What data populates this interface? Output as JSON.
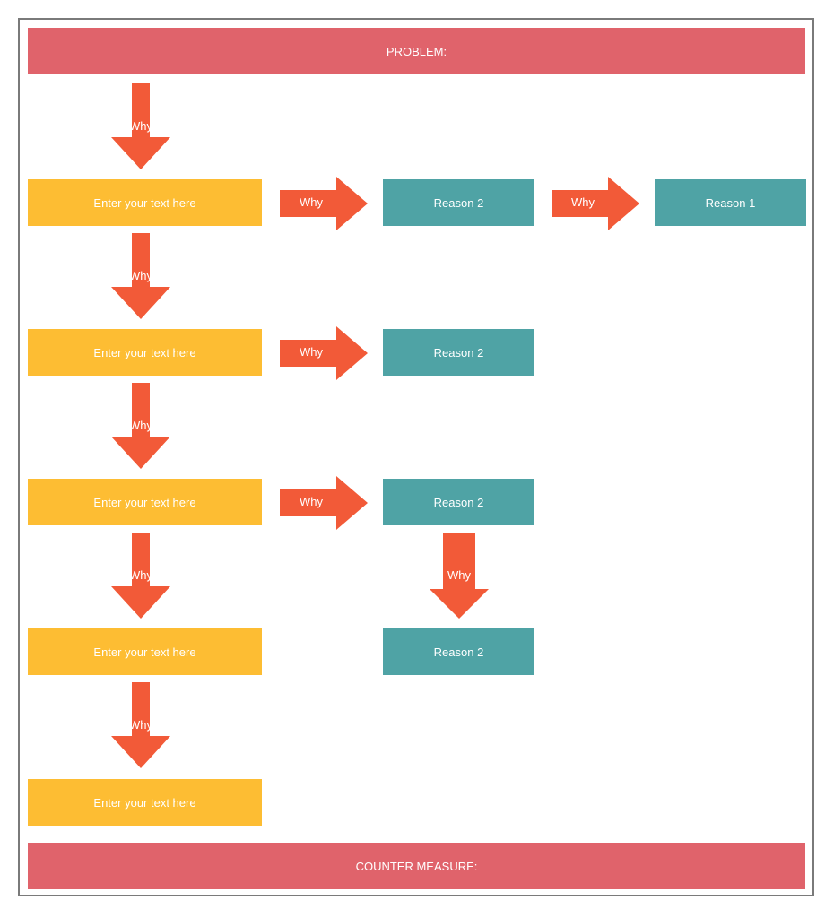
{
  "colors": {
    "banner": "#e0636b",
    "step": "#fdbd33",
    "reason": "#4fa3a5",
    "arrow": "#f25a38",
    "frame": "#7a7a7a"
  },
  "problem_label": "PROBLEM:",
  "counter_measure_label": "COUNTER MEASURE:",
  "arrow_label": "Why",
  "steps": [
    {
      "text": "Enter your text here"
    },
    {
      "text": "Enter your text here"
    },
    {
      "text": "Enter your text here"
    },
    {
      "text": "Enter your text here"
    },
    {
      "text": "Enter your text here"
    }
  ],
  "reasons": [
    {
      "text": "Reason 2"
    },
    {
      "text": "Reason 1"
    },
    {
      "text": "Reason 2"
    },
    {
      "text": "Reason 2"
    },
    {
      "text": "Reason 2"
    }
  ],
  "arrows": {
    "down": [
      "Why",
      "Why",
      "Why",
      "Why",
      "Why",
      "Why"
    ],
    "right": [
      "Why",
      "Why",
      "Why",
      "Why"
    ]
  }
}
